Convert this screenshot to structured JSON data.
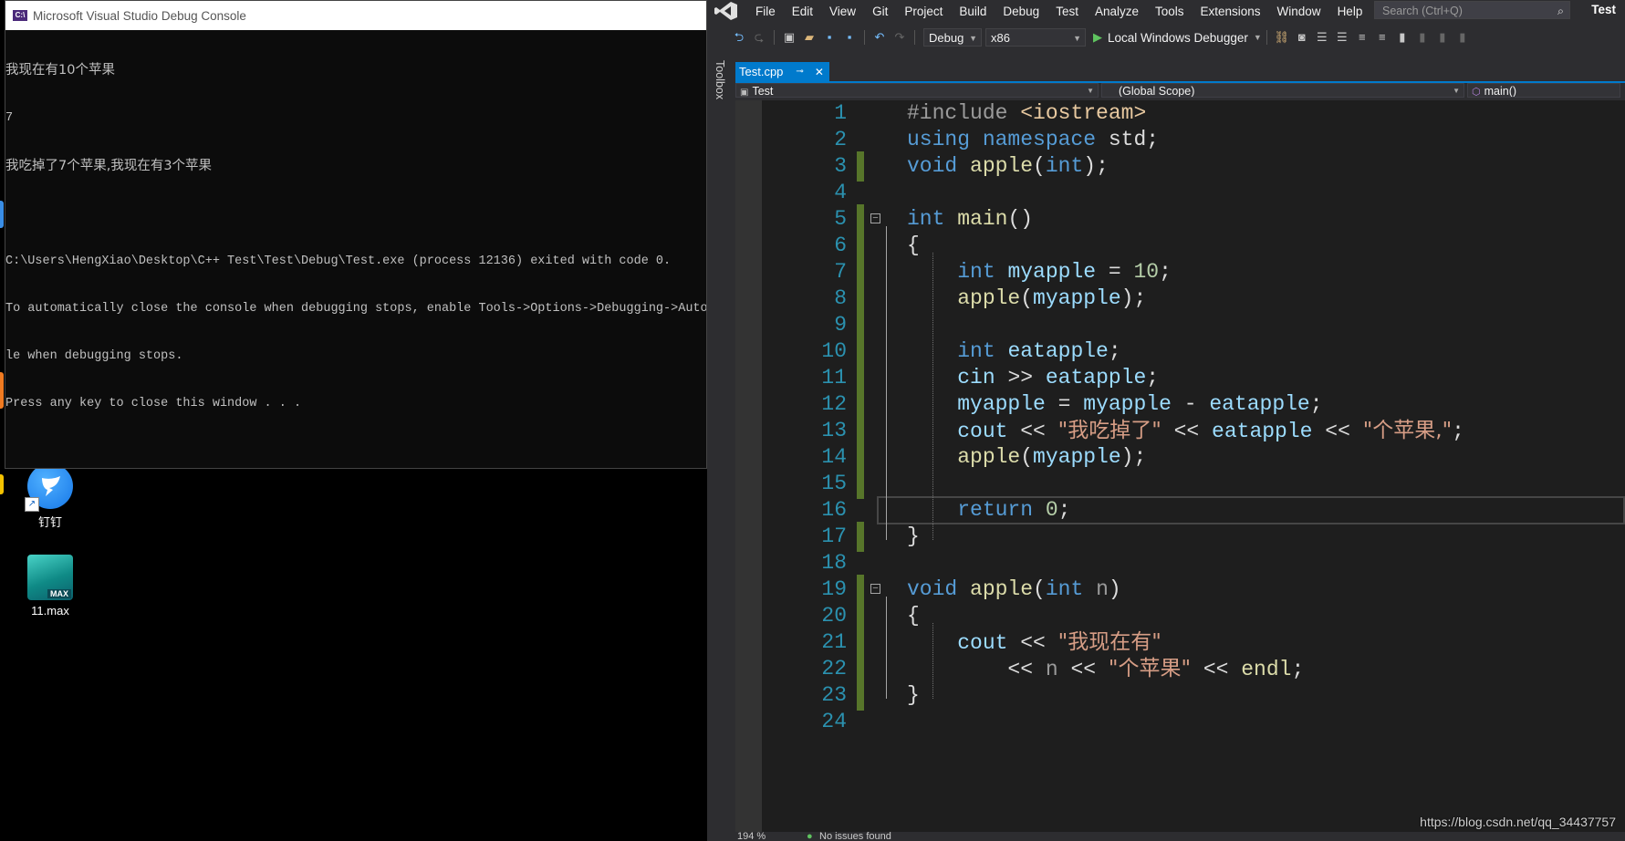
{
  "console": {
    "title": "Microsoft Visual Studio Debug Console",
    "icon_text": "C:\\",
    "lines": [
      "我现在有10个苹果",
      "7",
      "我吃掉了7个苹果,我现在有3个苹果",
      "",
      "C:\\Users\\HengXiao\\Desktop\\C++ Test\\Test\\Debug\\Test.exe (process 12136) exited with code 0.",
      "To automatically close the console when debugging stops, enable Tools->Options->Debugging->Autom",
      "le when debugging stops.",
      "Press any key to close this window . . ."
    ]
  },
  "desktop": {
    "icons": [
      {
        "label": "钉钉",
        "icon": "dingtalk-icon"
      },
      {
        "label": "11.max",
        "icon": "3ds-max-file-icon",
        "tag": "MAX"
      }
    ]
  },
  "vs": {
    "menu": [
      "File",
      "Edit",
      "View",
      "Git",
      "Project",
      "Build",
      "Debug",
      "Test",
      "Analyze",
      "Tools",
      "Extensions",
      "Window",
      "Help"
    ],
    "search_placeholder": "Search (Ctrl+Q)",
    "project_name": "Test",
    "toolbar": {
      "config": "Debug",
      "platform": "x86",
      "run_label": "Local Windows Debugger"
    },
    "toolbox_label": "Toolbox",
    "tab": {
      "name": "Test.cpp"
    },
    "nav": {
      "project": "Test",
      "scope": "(Global Scope)",
      "member": "main()"
    },
    "code_lines": [
      {
        "n": "1",
        "parts": [
          [
            "pp",
            "#include "
          ],
          [
            "inc",
            "<iostream>"
          ]
        ]
      },
      {
        "n": "2",
        "parts": [
          [
            "k",
            "using namespace "
          ],
          [
            "txt",
            "std;"
          ]
        ]
      },
      {
        "n": "3",
        "parts": [
          [
            "k",
            "void "
          ],
          [
            "fn",
            "apple"
          ],
          [
            "txt",
            "("
          ],
          [
            "k",
            "int"
          ],
          [
            "txt",
            ");"
          ]
        ]
      },
      {
        "n": "4",
        "parts": []
      },
      {
        "n": "5",
        "parts": [
          [
            "k",
            "int "
          ],
          [
            "fn",
            "main"
          ],
          [
            "txt",
            "()"
          ]
        ]
      },
      {
        "n": "6",
        "parts": [
          [
            "txt",
            "{"
          ]
        ]
      },
      {
        "n": "7",
        "parts": [
          [
            "txt",
            "    "
          ],
          [
            "k",
            "int "
          ],
          [
            "var",
            "myapple"
          ],
          [
            "txt",
            " = "
          ],
          [
            "num-lit",
            "10"
          ],
          [
            "txt",
            ";"
          ]
        ]
      },
      {
        "n": "8",
        "parts": [
          [
            "txt",
            "    "
          ],
          [
            "fn",
            "apple"
          ],
          [
            "txt",
            "("
          ],
          [
            "var",
            "myapple"
          ],
          [
            "txt",
            ");"
          ]
        ]
      },
      {
        "n": "9",
        "parts": []
      },
      {
        "n": "10",
        "parts": [
          [
            "txt",
            "    "
          ],
          [
            "k",
            "int "
          ],
          [
            "var",
            "eatapple"
          ],
          [
            "txt",
            ";"
          ]
        ]
      },
      {
        "n": "11",
        "parts": [
          [
            "txt",
            "    "
          ],
          [
            "var",
            "cin"
          ],
          [
            "txt",
            " >> "
          ],
          [
            "var",
            "eatapple"
          ],
          [
            "txt",
            ";"
          ]
        ]
      },
      {
        "n": "12",
        "parts": [
          [
            "txt",
            "    "
          ],
          [
            "var",
            "myapple"
          ],
          [
            "txt",
            " = "
          ],
          [
            "var",
            "myapple"
          ],
          [
            "txt",
            " - "
          ],
          [
            "var",
            "eatapple"
          ],
          [
            "txt",
            ";"
          ]
        ]
      },
      {
        "n": "13",
        "parts": [
          [
            "txt",
            "    "
          ],
          [
            "var",
            "cout"
          ],
          [
            "txt",
            " << "
          ],
          [
            "str",
            "\"我吃掉了\""
          ],
          [
            "txt",
            " << "
          ],
          [
            "var",
            "eatapple"
          ],
          [
            "txt",
            " << "
          ],
          [
            "str",
            "\"个苹果,\""
          ],
          [
            "txt",
            ";"
          ]
        ]
      },
      {
        "n": "14",
        "parts": [
          [
            "txt",
            "    "
          ],
          [
            "fn",
            "apple"
          ],
          [
            "txt",
            "("
          ],
          [
            "var",
            "myapple"
          ],
          [
            "txt",
            ");"
          ]
        ]
      },
      {
        "n": "15",
        "parts": []
      },
      {
        "n": "16",
        "parts": [
          [
            "txt",
            "    "
          ],
          [
            "k",
            "return "
          ],
          [
            "num-lit",
            "0"
          ],
          [
            "txt",
            ";"
          ]
        ]
      },
      {
        "n": "17",
        "parts": [
          [
            "txt",
            "}"
          ]
        ]
      },
      {
        "n": "18",
        "parts": []
      },
      {
        "n": "19",
        "parts": [
          [
            "k",
            "void "
          ],
          [
            "fn",
            "apple"
          ],
          [
            "txt",
            "("
          ],
          [
            "k",
            "int "
          ],
          [
            "param",
            "n"
          ],
          [
            "txt",
            ")"
          ]
        ]
      },
      {
        "n": "20",
        "parts": [
          [
            "txt",
            "{"
          ]
        ]
      },
      {
        "n": "21",
        "parts": [
          [
            "txt",
            "    "
          ],
          [
            "var",
            "cout"
          ],
          [
            "txt",
            " << "
          ],
          [
            "str",
            "\"我现在有\""
          ]
        ]
      },
      {
        "n": "22",
        "parts": [
          [
            "txt",
            "        << "
          ],
          [
            "param",
            "n"
          ],
          [
            "txt",
            " << "
          ],
          [
            "str",
            "\"个苹果\""
          ],
          [
            "txt",
            " << "
          ],
          [
            "fn",
            "endl"
          ],
          [
            "txt",
            ";"
          ]
        ]
      },
      {
        "n": "23",
        "parts": [
          [
            "txt",
            "}"
          ]
        ]
      },
      {
        "n": "24",
        "parts": []
      }
    ],
    "status": {
      "zoom": "194 %",
      "issues": "No issues found"
    }
  },
  "watermark": "https://blog.csdn.net/qq_34437757",
  "colors": {
    "accent": "#007acc",
    "change_bar": "#57752a",
    "keyword": "#569cd6",
    "string": "#d69d85",
    "line_number": "#2b91af"
  }
}
